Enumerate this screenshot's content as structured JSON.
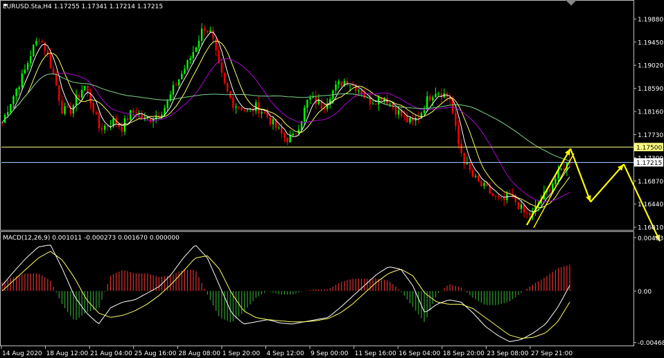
{
  "header": {
    "symbol_label": "EURUSD.Sta,H4  1.17255 1.17341 1.17214 1.17215",
    "macd_label": "MACD(12,26,9) 0.001011 -0.000273 0.001670 0.000000"
  },
  "colors": {
    "background": "#000000",
    "frame": "#c0c0c0",
    "bull": "#00ff00",
    "bear": "#ff0000",
    "ma_fast": "#ffffff",
    "ma_mid": "#ffff66",
    "ma_slow": "#b000d8",
    "ma_long": "#7fd68a",
    "hline_level": "#ffff80",
    "hline_price": "#a0c8ff",
    "forecast": "#ffff00",
    "macd_pos": "#e03030",
    "macd_neg": "#30a030",
    "macd_main": "#ffffff",
    "macd_signal": "#ffff66"
  },
  "chart_data": [
    {
      "type": "candlestick",
      "symbol": "EURUSD.Sta",
      "timeframe": "H4",
      "ohlc_last": {
        "open": 1.17255,
        "high": 1.17341,
        "low": 1.17214,
        "close": 1.17215
      },
      "ylim": [
        1.1596,
        1.2022
      ],
      "y_ticks": [
        "1.19880",
        "1.19450",
        "1.19020",
        "1.18590",
        "1.18160",
        "1.17730",
        "1.17300",
        "1.16870",
        "1.16440",
        "1.16010"
      ],
      "x_ticks": [
        "14 Aug 2020",
        "18 Aug 12:00",
        "21 Aug 04:00",
        "25 Aug 16:00",
        "28 Aug 08:00",
        "1 Sep 20:00",
        "4 Sep 12:00",
        "9 Sep 00:00",
        "11 Sep 16:00",
        "16 Sep 04:00",
        "18 Sep 20:00",
        "23 Sep 08:00",
        "27 Sep 21:00"
      ],
      "price_levels": [
        {
          "label": "1.17500",
          "value": 1.175
        },
        {
          "label": "1.17215",
          "value": 1.17215
        }
      ],
      "close_path": [
        1.1795,
        1.183,
        1.186,
        1.189,
        1.193,
        1.1955,
        1.1925,
        1.188,
        1.182,
        1.1815,
        1.184,
        1.1865,
        1.183,
        1.1785,
        1.179,
        1.18,
        1.1785,
        1.181,
        1.1818,
        1.1798,
        1.1805,
        1.1812,
        1.1828,
        1.186,
        1.1885,
        1.191,
        1.194,
        1.1975,
        1.196,
        1.19,
        1.1855,
        1.183,
        1.1825,
        1.1815,
        1.1825,
        1.1815,
        1.1798,
        1.178,
        1.1765,
        1.1768,
        1.18,
        1.184,
        1.1835,
        1.1825,
        1.185,
        1.1865,
        1.1875,
        1.1865,
        1.1855,
        1.1835,
        1.1838,
        1.1845,
        1.183,
        1.1815,
        1.18,
        1.1795,
        1.1812,
        1.184,
        1.1855,
        1.185,
        1.184,
        1.176,
        1.172,
        1.1695,
        1.168,
        1.167,
        1.1655,
        1.1648,
        1.166,
        1.1645,
        1.1625,
        1.1625,
        1.165,
        1.1668,
        1.169,
        1.171,
        1.1722
      ]
    },
    {
      "type": "macd",
      "params": "MACD(12,26,9)",
      "values": {
        "histogram": 0.001011,
        "signal": -0.000273,
        "main": 0.00167,
        "level": 0.0
      },
      "ylim": [
        -0.00495,
        0.0053
      ],
      "y_ticks": [
        "0.004836",
        "0.00",
        "-0.004681"
      ],
      "main_path": [
        0.0005,
        0.0018,
        0.003,
        0.004,
        0.0042,
        0.002,
        -0.0005,
        -0.002,
        -0.003,
        -0.0015,
        -0.001,
        -0.0008,
        -0.0002,
        0.0004,
        0.0015,
        0.003,
        0.0042,
        0.003,
        0.0005,
        -0.002,
        -0.003,
        -0.0028,
        -0.0026,
        -0.0029,
        -0.003,
        -0.0028,
        -0.0026,
        -0.0024,
        -0.0015,
        -0.0005,
        0.0005,
        0.0015,
        0.0022,
        0.002,
        0.0005,
        -0.002,
        -0.0012,
        -0.0008,
        -0.001,
        -0.002,
        -0.0032,
        -0.004,
        -0.0046,
        -0.0044,
        -0.0038,
        -0.003,
        -0.0015,
        0.0005
      ],
      "signal_path": [
        0.0,
        0.001,
        0.002,
        0.003,
        0.0036,
        0.0028,
        0.0012,
        -0.0008,
        -0.002,
        -0.0024,
        -0.0022,
        -0.0018,
        -0.0012,
        -0.0004,
        0.0006,
        0.0018,
        0.003,
        0.0032,
        0.002,
        -0.0002,
        -0.0018,
        -0.0024,
        -0.0026,
        -0.0027,
        -0.0028,
        -0.0028,
        -0.0027,
        -0.0025,
        -0.002,
        -0.0012,
        -0.0002,
        0.0008,
        0.0016,
        0.002,
        0.0014,
        -0.0002,
        -0.001,
        -0.0012,
        -0.0012,
        -0.0016,
        -0.0024,
        -0.0032,
        -0.004,
        -0.0043,
        -0.0042,
        -0.0038,
        -0.0028,
        -0.001
      ]
    }
  ]
}
